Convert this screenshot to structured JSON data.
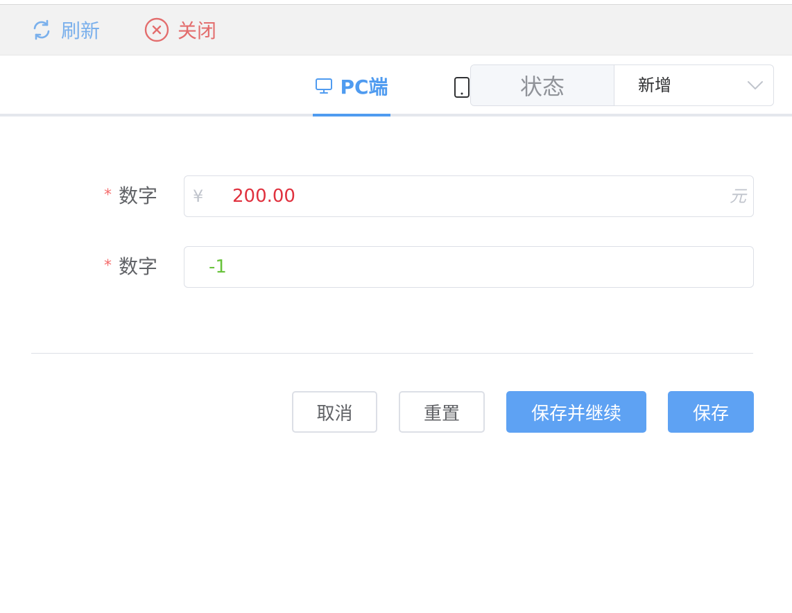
{
  "toolbar": {
    "refresh": {
      "label": "刷新",
      "icon": "refresh-icon",
      "color": "#7ab0ec"
    },
    "close": {
      "label": "关闭",
      "icon": "close-circle-icon",
      "color": "#e36d6d"
    }
  },
  "tabs": {
    "pc": {
      "label": "PC端",
      "icon": "monitor-icon",
      "active": true
    },
    "mobile": {
      "label": "",
      "icon": "tablet-icon",
      "active": false
    }
  },
  "status": {
    "prefix": "状态",
    "selected": "新增",
    "icon": "chevron-down-icon"
  },
  "form": {
    "fields": [
      {
        "required_mark": "*",
        "label": "数字",
        "prefix": "¥",
        "value": "200.00",
        "suffix": "元",
        "value_color": "#e0313e"
      },
      {
        "required_mark": "*",
        "label": "数字",
        "prefix": "",
        "value": "-1",
        "suffix": "",
        "value_color": "#67c23a"
      }
    ]
  },
  "actions": {
    "cancel": "取消",
    "reset": "重置",
    "save_continue": "保存并继续",
    "save": "保存",
    "primary_color": "#5ea2f3"
  }
}
